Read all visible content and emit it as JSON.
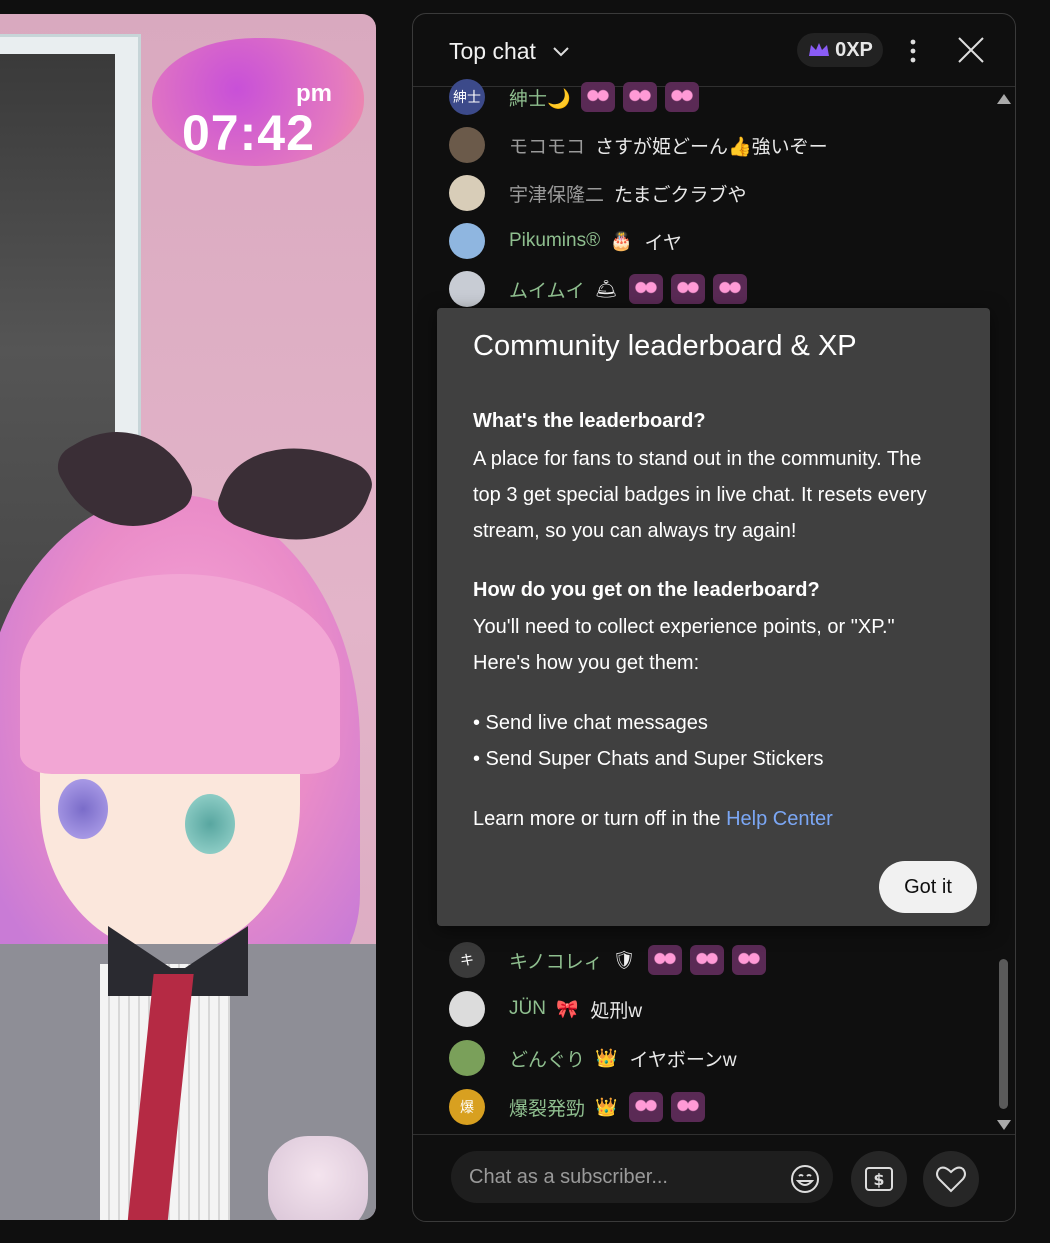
{
  "video": {
    "clock_ampm": "pm",
    "clock_time": "07:42"
  },
  "chat": {
    "title": "Top chat",
    "xp_label": "0XP",
    "input_placeholder": "Chat as a subscriber...",
    "messages_top": [
      {
        "avatar_text": "紳士",
        "author": "紳士🌙",
        "badge": "",
        "text": "",
        "emotes": 3,
        "author_color": "#8fbf8f",
        "avatar_color": "#3c4a8a"
      },
      {
        "avatar_text": "",
        "author": "モコモコ",
        "badge": "",
        "text": "さすが姫どーん👍強いぞー",
        "emotes": 0,
        "author_color": "#9a9a9a",
        "avatar_color": "#6b5a4a"
      },
      {
        "avatar_text": "",
        "author": "宇津保隆二",
        "badge": "",
        "text": "たまごクラブや",
        "emotes": 0,
        "author_color": "#9a9a9a",
        "avatar_color": "#d8cdb8"
      },
      {
        "avatar_text": "",
        "author": "Pikumins®",
        "badge": "🎂",
        "text": "イヤ",
        "emotes": 0,
        "author_color": "#8fbf8f",
        "avatar_color": "#8fb6e0"
      },
      {
        "avatar_text": "",
        "author": "ムイムイ",
        "badge": "🛎",
        "text": "",
        "emotes": 3,
        "author_color": "#8fbf8f",
        "avatar_color": "#c8ccd4"
      }
    ],
    "messages_bottom": [
      {
        "avatar_text": "キ",
        "author": "キノコレィ",
        "badge": "🛡",
        "text": "",
        "emotes": 3,
        "author_color": "#8fbf8f",
        "avatar_color": "#3a3a3a"
      },
      {
        "avatar_text": "",
        "author": "JÜN",
        "badge": "🎀",
        "text": "処刑w",
        "emotes": 0,
        "author_color": "#8fbf8f",
        "avatar_color": "#dcdcdc"
      },
      {
        "avatar_text": "",
        "author": "どんぐり",
        "badge": "👑",
        "text": "イヤボーンw",
        "emotes": 0,
        "author_color": "#8fbf8f",
        "avatar_color": "#7aa05a"
      },
      {
        "avatar_text": "爆",
        "author": "爆裂発勁",
        "badge": "👑",
        "text": "",
        "emotes": 2,
        "author_color": "#8fbf8f",
        "avatar_color": "#d8a020"
      }
    ]
  },
  "popup": {
    "title": "Community leaderboard & XP",
    "q1": "What's the leaderboard?",
    "a1_lines": [
      "A place for fans to stand out in the community. The",
      "top 3 get special badges in live chat. It resets every",
      "stream, so you can always try again!"
    ],
    "q2": "How do you get on the leaderboard?",
    "a2_lines": [
      "You'll need to collect experience points, or \"XP.\"",
      "Here's how you get them:"
    ],
    "bullets": [
      "• Send live chat messages",
      "• Send Super Chats and Super Stickers"
    ],
    "learn_more_prefix": "Learn more or turn off in the ",
    "learn_more_link": "Help Center",
    "button_label": "Got it"
  },
  "colors": {
    "accent_link": "#7ba7f5",
    "xp_crown": "#8a5cf6"
  }
}
